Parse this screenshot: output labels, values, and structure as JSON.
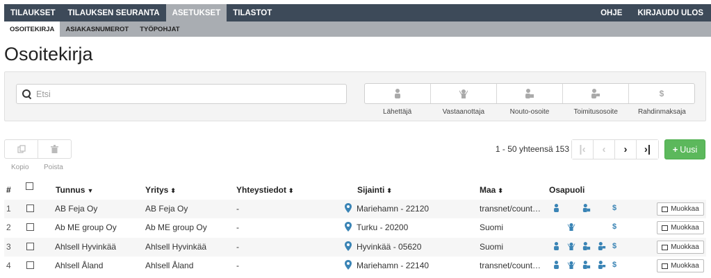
{
  "topnav": {
    "left": [
      "TILAUKSET",
      "TILAUKSEN SEURANTA",
      "ASETUKSET",
      "TILASTOT"
    ],
    "right": [
      "OHJE",
      "KIRJAUDU ULOS"
    ],
    "active": "ASETUKSET"
  },
  "subnav": {
    "items": [
      "OSOITEKIRJA",
      "ASIAKASNUMEROT",
      "TYÖPOHJAT"
    ],
    "active": "OSOITEKIRJA"
  },
  "page_title": "Osoitekirja",
  "search": {
    "placeholder": "Etsi",
    "value": ""
  },
  "parties": [
    {
      "label": "Lähettäjä",
      "icon": "person-icon"
    },
    {
      "label": "Vastaanottaja",
      "icon": "receiver-icon"
    },
    {
      "label": "Nouto-osoite",
      "icon": "pickup-icon"
    },
    {
      "label": "Toimitusosoite",
      "icon": "delivery-icon"
    },
    {
      "label": "Rahdinmaksaja",
      "icon": "dollar-icon"
    }
  ],
  "toolbar": {
    "copy_label": "Kopio",
    "delete_label": "Poista"
  },
  "paging": {
    "text": "1 - 50 yhteensä 153"
  },
  "new_button": {
    "label": "Uusi"
  },
  "table": {
    "headers": {
      "num": "#",
      "tunnus": "Tunnus",
      "yritys": "Yritys",
      "yhteystiedot": "Yhteystiedot",
      "sijainti": "Sijainti",
      "maa": "Maa",
      "osapuoli": "Osapuoli"
    },
    "edit_label": "Muokkaa",
    "rows": [
      {
        "num": "1",
        "tunnus": "AB Feja Oy",
        "yritys": "AB Feja Oy",
        "yhteystiedot": "-",
        "sijainti": "Mariehamn - 22120",
        "maa": "transnet/count…",
        "osapuoli": [
          "person",
          "",
          "pickup",
          "",
          "dollar"
        ]
      },
      {
        "num": "2",
        "tunnus": "Ab ME group Oy",
        "yritys": "Ab ME group Oy",
        "yhteystiedot": "-",
        "sijainti": "Turku - 20200",
        "maa": "Suomi",
        "osapuoli": [
          "",
          "receiver",
          "",
          "",
          "dollar"
        ]
      },
      {
        "num": "3",
        "tunnus": "Ahlsell Hyvinkää",
        "yritys": "Ahlsell Hyvinkää",
        "yhteystiedot": "-",
        "sijainti": "Hyvinkää - 05620",
        "maa": "Suomi",
        "osapuoli": [
          "person",
          "receiver",
          "pickup",
          "delivery",
          "dollar"
        ]
      },
      {
        "num": "4",
        "tunnus": "Ahlsell Åland",
        "yritys": "Ahlsell Åland",
        "yhteystiedot": "-",
        "sijainti": "Mariehamn - 22140",
        "maa": "transnet/count…",
        "osapuoli": [
          "person",
          "receiver",
          "pickup",
          "delivery",
          "dollar"
        ]
      }
    ]
  },
  "colors": {
    "nav_bg": "#3d4a59",
    "subnav_bg": "#a9adb2",
    "accent": "#3a84b5",
    "success": "#5cb85c"
  }
}
